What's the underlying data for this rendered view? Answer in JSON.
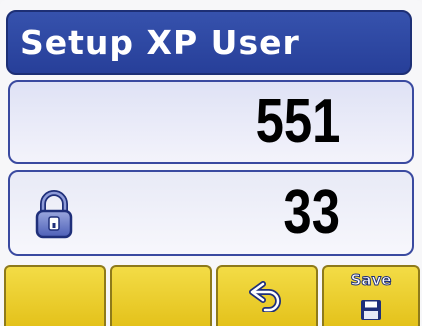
{
  "title": "Setup XP User",
  "fields": [
    {
      "value": "551",
      "locked": false
    },
    {
      "value": "33",
      "locked": true,
      "icon": "lock-icon"
    }
  ],
  "softkeys": [
    {
      "label": "",
      "icon": ""
    },
    {
      "label": "",
      "icon": ""
    },
    {
      "label": "",
      "icon": "undo-icon"
    },
    {
      "label": "Save",
      "icon": "floppy-disk-icon"
    }
  ],
  "colors": {
    "title_bg": "#2b449e",
    "field_border": "#3a4aa0",
    "softkey_bg": "#ecd030",
    "icon_blue": "#1f2f7a"
  }
}
